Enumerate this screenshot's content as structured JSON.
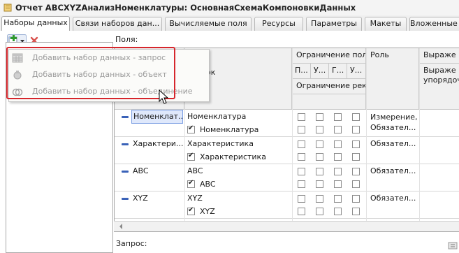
{
  "window": {
    "title": "Отчет ABCXYZАнализНоменклатуры: ОсновнаяСхемаКомпоновкиДанных"
  },
  "tabs": [
    {
      "label": "Наборы данных",
      "active": true
    },
    {
      "label": "Связи наборов дан..."
    },
    {
      "label": "Вычисляемые поля"
    },
    {
      "label": "Ресурсы"
    },
    {
      "label": "Параметры"
    },
    {
      "label": "Макеты"
    },
    {
      "label": "Вложенные сх"
    }
  ],
  "fields_label": "Поля:",
  "columns": {
    "header_title_partial": "оловок",
    "restriction_field": "Ограничение поля",
    "restriction_field_subs": [
      "П...",
      "У...",
      "Г...",
      "У..."
    ],
    "restriction_req": "Ограничение рек...",
    "role": "Роль",
    "expression": "Выраже",
    "expression_order": "Выраже упорядочи"
  },
  "rows": [
    {
      "field": "Номенклат...",
      "title": "Номенклатура",
      "title2": "Номенклатура",
      "role": "Измерение, Обязател..."
    },
    {
      "field": "Характери...",
      "title": "Характеристика",
      "title2": "Характеристика",
      "role": "Обязател..."
    },
    {
      "field": "ABC",
      "title": "ABC",
      "title2": "ABC",
      "role": "Обязател..."
    },
    {
      "field": "XYZ",
      "title": "XYZ",
      "title2": "XYZ",
      "role": "Обязател..."
    }
  ],
  "query_label": "Запрос:",
  "menu": [
    {
      "label": "Добавить набор данных - запрос",
      "icon": "table-icon"
    },
    {
      "label": "Добавить набор данных - объект",
      "icon": "object-icon"
    },
    {
      "label": "Добавить набор данных - объединение",
      "icon": "union-icon"
    }
  ],
  "colors": {
    "frame": "#d6262c",
    "selection": "#dfe8fb",
    "accent": "#3a62b8"
  }
}
